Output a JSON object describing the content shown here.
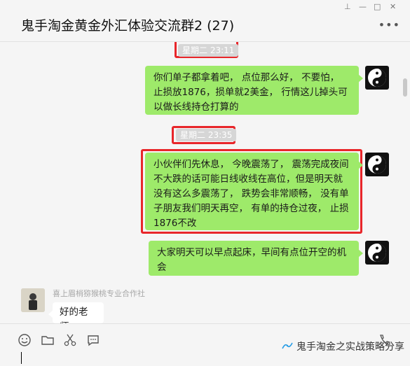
{
  "window": {
    "title": "鬼手淘金黄金外汇体验交流群2 (27)"
  },
  "controls": {
    "pin": "⊥",
    "minimize": "—",
    "maximize": "□",
    "close": "✕",
    "more": "•••"
  },
  "messages": [
    {
      "type": "timestamp",
      "text": "星期二 23:11",
      "highlighted": true
    },
    {
      "type": "outgoing",
      "text": "你们单子都拿着吧， 点位那么好， 不要怕， 止损放1876，损单就2美金， 行情这儿掉头可以做长线持仓打算的"
    },
    {
      "type": "timestamp",
      "text": "星期二 23:35",
      "highlighted": true
    },
    {
      "type": "outgoing",
      "text": "小伙伴们先休息， 今晚震荡了， 震荡完成夜间不大跌的话可能日线收线在高位，但是明天就没有这么多震荡了， 跌势会非常顺畅， 没有单子朋友我们明天再空， 有单的持仓过夜， 止损1876不改",
      "highlighted": true
    },
    {
      "type": "outgoing",
      "text": "大家明天可以早点起床，早间有点位开空的机会"
    },
    {
      "type": "incoming",
      "sender": "喜上眉梢猕猴桃专业合作社",
      "text": "好的老师"
    }
  ],
  "watermark": {
    "text": "鬼手淘金之实战策略分享"
  },
  "colors": {
    "outgoing_bubble": "#9eea6a",
    "incoming_bubble": "#ffffff",
    "highlight": "#e8262a",
    "background": "#f5f5f5"
  },
  "icons": [
    "emoji-icon",
    "folder-icon",
    "scissors-icon",
    "chat-history-icon",
    "voice-call-icon"
  ]
}
